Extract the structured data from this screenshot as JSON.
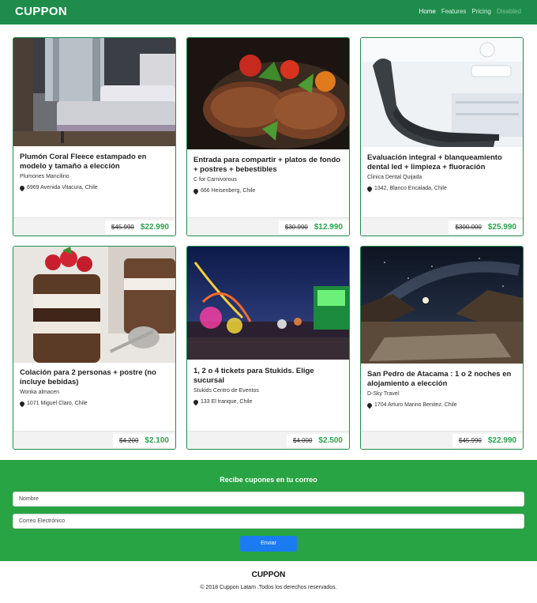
{
  "navbar": {
    "brand": "CUPPON",
    "items": [
      {
        "label": "Home",
        "state": "active"
      },
      {
        "label": "Features",
        "state": "normal"
      },
      {
        "label": "Pricing",
        "state": "normal"
      },
      {
        "label": "Disabled",
        "state": "disabled"
      }
    ]
  },
  "cards": [
    {
      "title": "Plumón Coral Fleece estampado en modelo y tamaño a elección",
      "merchant": "Plumones Mancilino",
      "address": "6969 Avenida Vitacura, Chile",
      "old_price": "$45.990",
      "new_price": "$22.990",
      "image": "bedroom-photo"
    },
    {
      "title": "Entrada para compartir + platos de fondo + postres + bebestibles",
      "merchant": "C for Carnivorous",
      "address": "666 Heisenberg, Chile",
      "old_price": "$30.990",
      "new_price": "$12.990",
      "image": "steak-photo"
    },
    {
      "title": "Evaluación integral + blanqueamiento dental led + limpieza + fluoración",
      "merchant": "Clinica Dental Quijada",
      "address": "1342, Blanco Encalada, Chile",
      "old_price": "$300.000",
      "new_price": "$25.990",
      "image": "dental-chair-photo"
    },
    {
      "title": "Colación para 2 personas + postre (no incluye bebidas)",
      "merchant": "Wonka almacen",
      "address": "1071 Miguel Claro, Chile",
      "old_price": "$4.200",
      "new_price": "$2.100",
      "image": "dessert-photo"
    },
    {
      "title": "1, 2 o 4 tickets para Stukids. Elige sucursal",
      "merchant": "Stukids Centro de Eventos",
      "address": "133 El tranque, Chile",
      "old_price": "$4.000",
      "new_price": "$2.500",
      "image": "fairground-photo"
    },
    {
      "title": "San Pedro de Atacama : 1 o 2 noches en alojamiento a elección",
      "merchant": "D-Sky Travel",
      "address": "1704 Arturo Marino Benitez, Chile",
      "old_price": "$45.990",
      "new_price": "$22.990",
      "image": "night-desert-photo"
    }
  ],
  "signup": {
    "title": "Recibe cupones en tu correo",
    "name_placeholder": "Nombre",
    "email_placeholder": "Correo Electrónico",
    "submit_label": "Enviar"
  },
  "footer": {
    "brand": "CUPPON",
    "copyright": "© 2018 Cuppon Latam .Todos los derechos reservados."
  },
  "colors": {
    "navbar": "#1e8d4c",
    "signup_bg": "#29a444",
    "price": "#2aa24e",
    "button": "#1a7cf0"
  }
}
